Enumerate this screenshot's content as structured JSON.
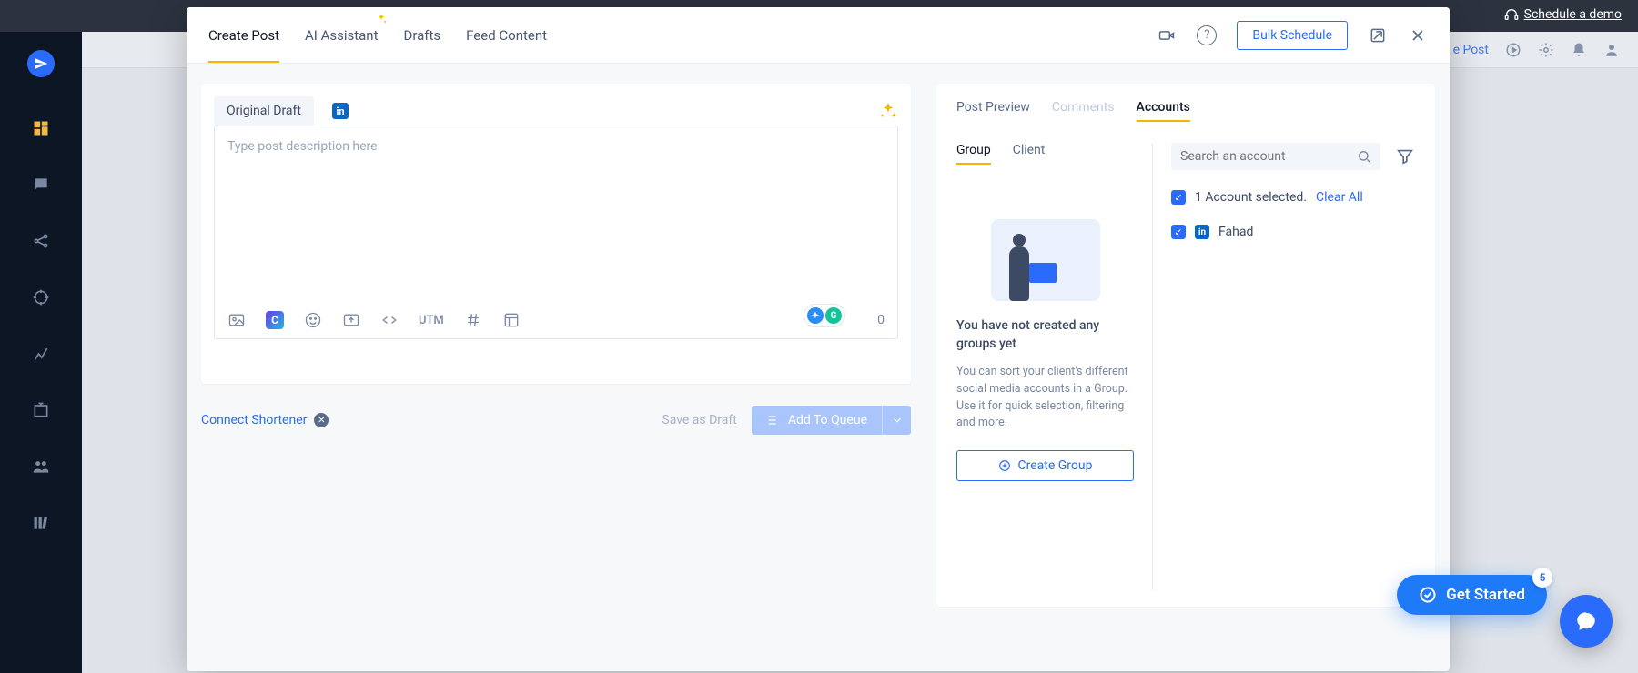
{
  "topbar": {
    "schedule_demo": "Schedule a demo"
  },
  "appbar": {
    "create_post": "e Post"
  },
  "sidebar": {
    "items": [
      "dashboard",
      "comments",
      "share",
      "target",
      "analytics",
      "inbox",
      "users",
      "library"
    ]
  },
  "modal": {
    "tabs": {
      "create_post": "Create Post",
      "ai_assistant": "AI Assistant",
      "drafts": "Drafts",
      "feed_content": "Feed Content"
    },
    "bulk_schedule": "Bulk Schedule"
  },
  "composer": {
    "original_draft": "Original Draft",
    "placeholder": "Type post description here",
    "char_count": "0",
    "utm": "UTM",
    "connect_shortener": "Connect Shortener",
    "save_as_draft": "Save as Draft",
    "add_to_queue": "Add To Queue"
  },
  "right": {
    "tabs": {
      "post_preview": "Post Preview",
      "comments": "Comments",
      "accounts": "Accounts"
    },
    "sub_tabs": {
      "group": "Group",
      "client": "Client"
    },
    "empty_title": "You have not created any groups yet",
    "empty_body": "You can sort your client's different social media accounts in a Group. Use it for quick selection, filtering and more.",
    "create_group": "Create Group",
    "search_placeholder": "Search an account",
    "selected_text": "1 Account selected.",
    "clear_all": "Clear All",
    "accounts": [
      {
        "name": "Fahad",
        "network": "linkedin",
        "checked": true
      }
    ]
  },
  "get_started": {
    "label": "Get Started",
    "badge": "5"
  }
}
